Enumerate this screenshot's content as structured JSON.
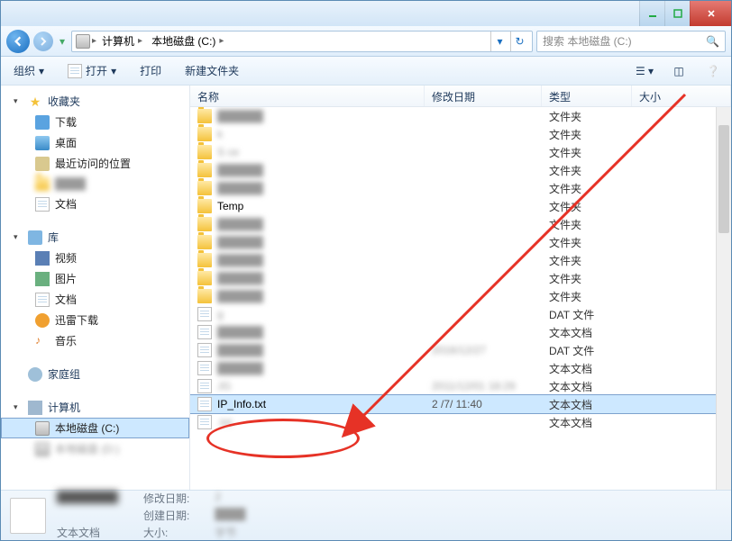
{
  "breadcrumb": {
    "computer": "计算机",
    "drive": "本地磁盘 (C:)"
  },
  "search": {
    "placeholder": "搜索 本地磁盘 (C:)"
  },
  "toolbar": {
    "organize": "组织",
    "open": "打开",
    "print": "打印",
    "new_folder": "新建文件夹"
  },
  "sidebar": {
    "favorites": {
      "header": "收藏夹",
      "downloads": "下载",
      "desktop": "桌面",
      "recent": "最近访问的位置",
      "blur1": "",
      "docs": "文档"
    },
    "libraries": {
      "header": "库",
      "videos": "视频",
      "pictures": "图片",
      "docs": "文档",
      "xunlei": "迅雷下载",
      "music": "音乐"
    },
    "homegroup": {
      "header": "家庭组"
    },
    "computer": {
      "header": "计算机",
      "drive_c": "本地磁盘 (C:)",
      "drive_d_blur": "本地磁盘 (D:)"
    }
  },
  "columns": {
    "name": "名称",
    "date": "修改日期",
    "type": "类型",
    "size": "大小"
  },
  "files": [
    {
      "name": "",
      "type": "文件夹",
      "blur": true,
      "icon": "folder"
    },
    {
      "name": "      k",
      "type": "文件夹",
      "blur": true,
      "icon": "folder"
    },
    {
      "name": "S         ce",
      "type": "文件夹",
      "blur": true,
      "icon": "folder"
    },
    {
      "name": "",
      "type": "文件夹",
      "blur": true,
      "icon": "folder"
    },
    {
      "name": "",
      "type": "文件夹",
      "blur": true,
      "icon": "folder"
    },
    {
      "name": "Temp",
      "type": "文件夹",
      "blur": false,
      "icon": "folder"
    },
    {
      "name": "",
      "type": "文件夹",
      "blur": true,
      "icon": "folder"
    },
    {
      "name": "",
      "type": "文件夹",
      "blur": true,
      "icon": "folder"
    },
    {
      "name": "",
      "type": "文件夹",
      "blur": true,
      "icon": "folder"
    },
    {
      "name": "",
      "type": "文件夹",
      "blur": true,
      "icon": "folder"
    },
    {
      "name": "",
      "type": "文件夹",
      "blur": true,
      "icon": "folder"
    },
    {
      "name": "          g",
      "type": "DAT 文件",
      "blur": true,
      "icon": "doc"
    },
    {
      "name": "",
      "type": "文本文档",
      "blur": true,
      "icon": "doc"
    },
    {
      "name": "",
      "date": "2016/12/27",
      "type": "DAT 文件",
      "blur": true,
      "icon": "doc"
    },
    {
      "name": "",
      "type": "文本文档",
      "blur": true,
      "icon": "doc"
    },
    {
      "name": "            JG",
      "date": "2011/12/01 18:29",
      "type": "文本文档",
      "blur": true,
      "icon": "doc"
    },
    {
      "name": "IP_Info.txt",
      "date": "2   /7/    11:40",
      "type": "文本文档",
      "blur": false,
      "icon": "doc",
      "selected": true
    },
    {
      "name": "    .txt",
      "type": "文本文档",
      "blur": true,
      "icon": "doc"
    }
  ],
  "details": {
    "date_modified_lbl": "修改日期:",
    "date_modified_val": "2",
    "type_lbl": "文本文档",
    "date_created_lbl": "创建日期:",
    "date_created_val": "",
    "size_lbl": "大小:",
    "size_val": "  字节"
  }
}
